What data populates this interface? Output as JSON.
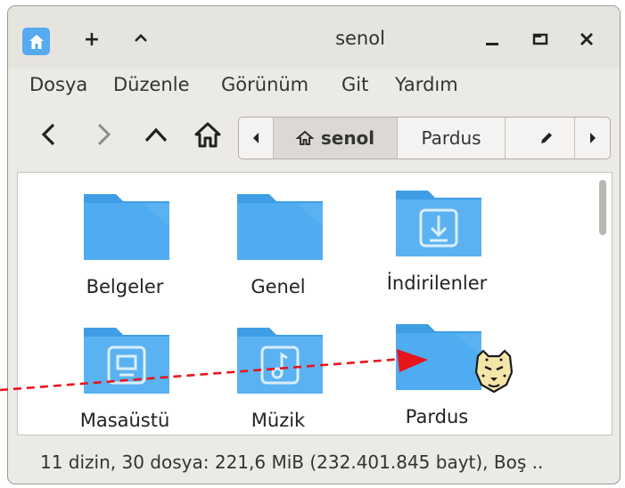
{
  "window": {
    "title": "senol",
    "new_tab_icon": "+",
    "up_icon": "^"
  },
  "menu": [
    "Dosya",
    "Düzenle",
    "Görünüm",
    "Git",
    "Yardım"
  ],
  "pathbar": {
    "current": "senol",
    "next": "Pardus"
  },
  "files": [
    {
      "name": "Belgeler",
      "icon": "folder"
    },
    {
      "name": "Genel",
      "icon": "folder"
    },
    {
      "name": "İndirilenler",
      "icon": "download-folder"
    },
    {
      "name": "Masaüstü",
      "icon": "desktop-folder"
    },
    {
      "name": "Müzik",
      "icon": "music-folder"
    },
    {
      "name": "Pardus",
      "icon": "folder"
    }
  ],
  "status": "11 dizin, 30 dosya: 221,6 MiB (232.401.845 bayt), Boş ..",
  "colors": {
    "folder": "#3f9de6",
    "folder_light": "#5bb2f2",
    "accent_arrow": "#e8141c"
  }
}
